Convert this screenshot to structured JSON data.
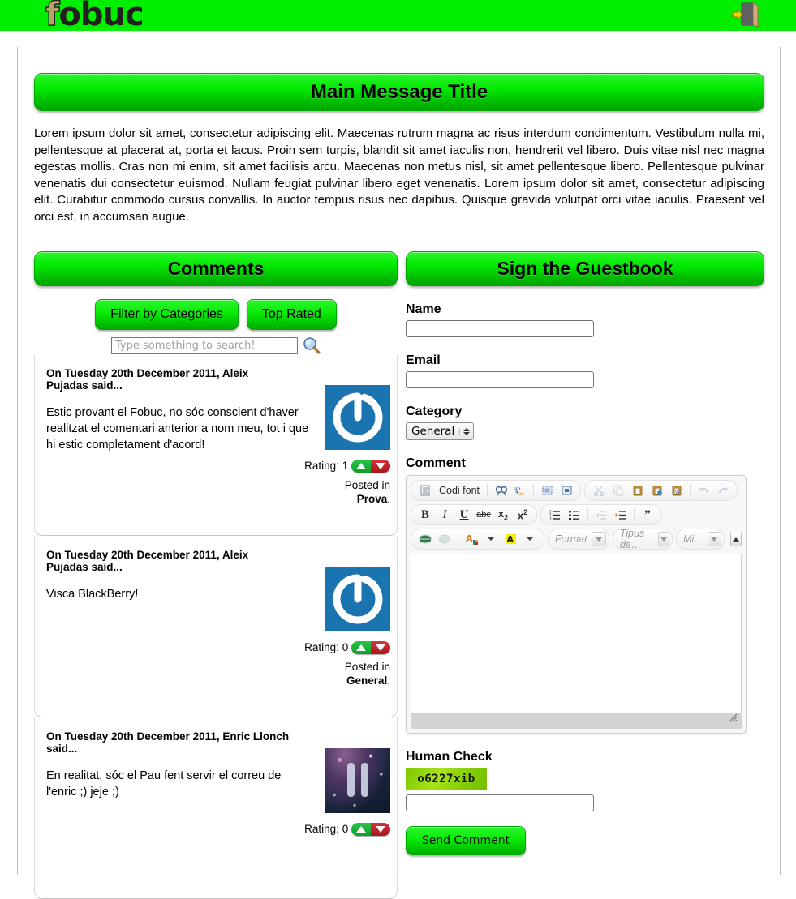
{
  "header": {
    "logo_f": "f",
    "logo_rest": "obuc",
    "logout_icon": "exit-door-icon"
  },
  "main": {
    "title": "Main Message Title",
    "intro": "Lorem ipsum dolor sit amet, consectetur adipiscing elit. Maecenas rutrum magna ac risus interdum condimentum. Vestibulum nulla mi, pellentesque at placerat at, porta et lacus. Proin sem turpis, blandit sit amet iaculis non, hendrerit vel libero. Duis vitae nisl nec magna egestas mollis. Cras non mi enim, sit amet facilisis arcu. Maecenas non metus nisl, sit amet pellentesque libero. Pellentesque pulvinar venenatis dui consectetur euismod. Nullam feugiat pulvinar libero eget venenatis. Lorem ipsum dolor sit amet, consectetur adipiscing elit. Curabitur commodo cursus convallis. In auctor tempus risus nec dapibus. Quisque gravida volutpat orci vitae iaculis. Praesent vel orci est, in accumsan augue."
  },
  "comments_panel": {
    "title": "Comments",
    "filter_button": "Filter by Categories",
    "top_rated_button": "Top Rated",
    "search_placeholder": "Type something to search!",
    "search_value": "",
    "search_icon": "magnifier-icon",
    "rating_label": "Rating:",
    "posted_in_label": "Posted in",
    "items": [
      {
        "head": "On Tuesday 20th December 2011, Aleix Pujadas said...",
        "body": "Estic provant el Fobuc, no sóc conscient d'haver realitzat el comentari anterior a nom meu, tot i que hi estic completament d'acord!",
        "rating": "1",
        "category": "Prova",
        "avatar": "gravatar-default-icon"
      },
      {
        "head": "On Tuesday 20th December 2011, Aleix Pujadas said...",
        "body": "Visca BlackBerry!",
        "rating": "0",
        "category": "General",
        "avatar": "gravatar-default-icon"
      },
      {
        "head": "On Tuesday 20th December 2011, Enric Llonch said...",
        "body": "En realitat, sóc el Pau fent servir el correu de l'enric ;) jeje ;)",
        "rating": "0",
        "category": "",
        "avatar": "space-photo-avatar"
      }
    ]
  },
  "guestbook": {
    "title": "Sign the Guestbook",
    "name_label": "Name",
    "name_value": "",
    "email_label": "Email",
    "email_value": "",
    "category_label": "Category",
    "category_selected": "General",
    "comment_label": "Comment",
    "human_check_label": "Human Check",
    "captcha_code": "o6227xib",
    "captcha_value": "",
    "send_button": "Send Comment"
  },
  "editor": {
    "source_label": "Codi font",
    "format_select": "Format",
    "font_select": "Tipus de…",
    "size_select": "Mi…",
    "content": "",
    "buttons_row1": [
      "source-icon",
      "find-icon",
      "replace-icon",
      "select-all-icon",
      "show-blocks-icon",
      "cut-icon",
      "copy-icon",
      "paste-icon",
      "paste-text-icon",
      "paste-word-icon",
      "undo-icon",
      "redo-icon"
    ],
    "buttons_row2": [
      "bold-icon",
      "italic-icon",
      "underline-icon",
      "strikethrough-icon",
      "subscript-icon",
      "superscript-icon",
      "numbered-list-icon",
      "bulleted-list-icon",
      "outdent-icon",
      "indent-icon",
      "blockquote-icon"
    ],
    "buttons_row3": [
      "link-icon",
      "unlink-icon",
      "text-color-icon",
      "background-color-icon",
      "collapse-toolbar-icon"
    ]
  },
  "colors": {
    "brand_green": "#00ee00",
    "banner_green_top": "#2bf62b",
    "banner_green_bottom": "#00a400",
    "avatar_blue": "#1a74b0",
    "rating_up": "#0e9e2a",
    "rating_down": "#a8161f",
    "captcha_green": "#a8e21a"
  }
}
